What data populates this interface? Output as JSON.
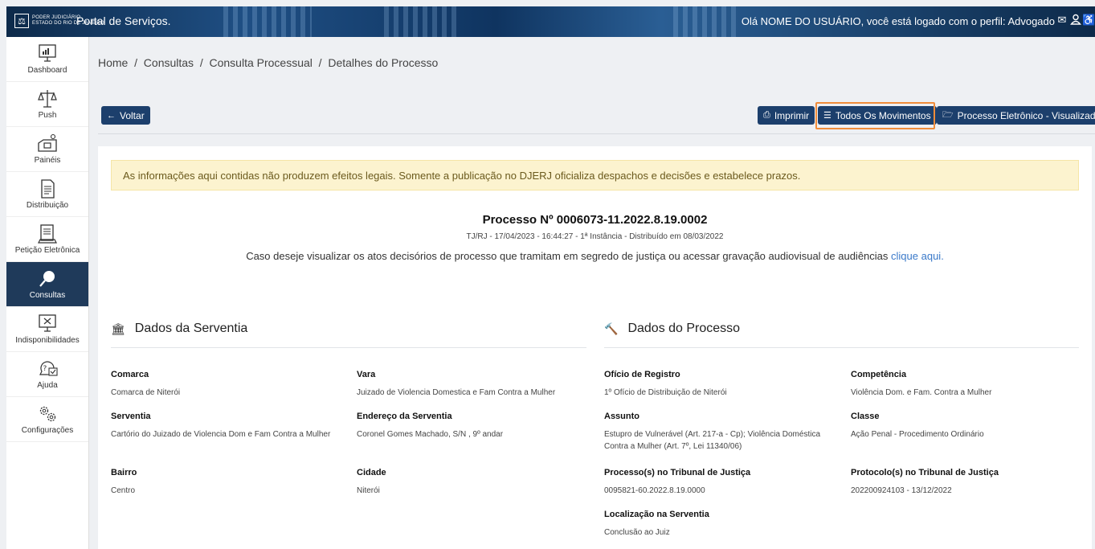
{
  "topbar": {
    "logo_text": [
      "PODER JUDICIÁRIO",
      "ESTADO DO RIO DE JANEIRO"
    ],
    "app_title": "Portal de Serviços.",
    "greeting": "Olá NOME DO USUÁRIO, você está logado com o perfil: Advogado"
  },
  "sidebar": {
    "items": [
      {
        "label": "Dashboard",
        "icon": "dashboard-icon"
      },
      {
        "label": "Push",
        "icon": "scale-icon"
      },
      {
        "label": "Painéis",
        "icon": "panels-icon"
      },
      {
        "label": "Distribuição",
        "icon": "document-icon"
      },
      {
        "label": "Petição Eletrônica",
        "icon": "petition-icon"
      },
      {
        "label": "Consultas",
        "icon": "search-icon"
      },
      {
        "label": "Indisponibilidades",
        "icon": "unavailable-icon"
      },
      {
        "label": "Ajuda",
        "icon": "help-icon"
      },
      {
        "label": "Configurações",
        "icon": "settings-icon"
      }
    ]
  },
  "breadcrumb": "Home  /  Consultas  /  Consulta Processual  /  Detalhes do Processo",
  "buttons": {
    "back": "Voltar",
    "print": "Imprimir",
    "all_moves": "Todos Os Movimentos",
    "viewer": "Processo Eletrônico - Visualizador"
  },
  "alert": "As informações aqui contidas não produzem efeitos legais. Somente a publicação no DJERJ oficializa despachos e decisões e estabelece prazos.",
  "process": {
    "title": "Processo Nº 0006073-11.2022.8.19.0002",
    "subtitle": "TJ/RJ - 17/04/2023 - 16:44:27 - 1ª Instância - Distribuído em 08/03/2022",
    "note": "Caso deseje visualizar os atos decisórios de processo que tramitam em segredo de justiça ou acessar gravação audiovisual de audiências",
    "note_link": "clique aqui."
  },
  "serventia": {
    "heading": "Dados da Serventia",
    "comarca_label": "Comarca",
    "comarca": "Comarca de Niterói",
    "vara_label": "Vara",
    "vara": "Juizado de Violencia Domestica e Fam Contra a Mulher",
    "serventia_label": "Serventia",
    "serventia": "Cartório do Juizado de Violencia Dom e Fam Contra a Mulher",
    "endereco_label": "Endereço da Serventia",
    "endereco": "Coronel Gomes Machado, S/N , 9º andar",
    "bairro_label": "Bairro",
    "bairro": "Centro",
    "cidade_label": "Cidade",
    "cidade": "Niterói"
  },
  "processo": {
    "heading": "Dados do Processo",
    "oficio_label": "Ofício de Registro",
    "oficio": "1º Ofício de Distribuição de Niterói",
    "competencia_label": "Competência",
    "competencia": "Violência Dom. e Fam. Contra a Mulher",
    "assunto_label": "Assunto",
    "assunto": "Estupro de Vulnerável (Art. 217-a - Cp); Violência Doméstica Contra a Mulher (Art. 7º, Lei 11340/06)",
    "classe_label": "Classe",
    "classe": "Ação Penal - Procedimento Ordinário",
    "tribunal_label": "Processo(s) no Tribunal de Justiça",
    "tribunal": "0095821-60.2022.8.19.0000",
    "protocolo_label": "Protocolo(s) no Tribunal de Justiça",
    "protocolo": "202200924103 - 13/12/2022",
    "localizacao_label": "Localização na Serventia",
    "localizacao": "Conclusão ao Juiz"
  }
}
